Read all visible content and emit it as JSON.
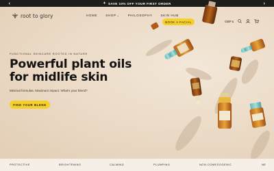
{
  "announcement": {
    "text": "SAVE 10% OFF YOUR FIRST ORDER",
    "icon": "sparkle-icon"
  },
  "brand": {
    "name": "root to glory",
    "accent": "#f6cf2b"
  },
  "nav": {
    "items": [
      {
        "label": "HOME",
        "dropdown": false
      },
      {
        "label": "SHOP",
        "dropdown": true
      },
      {
        "label": "PHILOSOPHY",
        "dropdown": false
      },
      {
        "label": "SKIN HUB",
        "dropdown": false
      }
    ],
    "cta_label": "BOOK A FACIAL",
    "currency": "GBP £",
    "icons": [
      "search-icon",
      "account-icon",
      "cart-icon"
    ]
  },
  "hero": {
    "eyebrow": "FUNCTIONAL SKINCARE ROOTED IN NATURE",
    "headline_line1": "Powerful plant oils",
    "headline_line2": "for midlife skin",
    "subcopy": "Minimal formulas. Maximum impact. What's your blend?",
    "cta_label": "FIND YOUR BLEND"
  },
  "benefits": [
    "PROTECTIVE",
    "BRIGHTENING",
    "CALMING",
    "PLUMPING",
    "NON-COMEDOGENIC",
    "NE"
  ]
}
